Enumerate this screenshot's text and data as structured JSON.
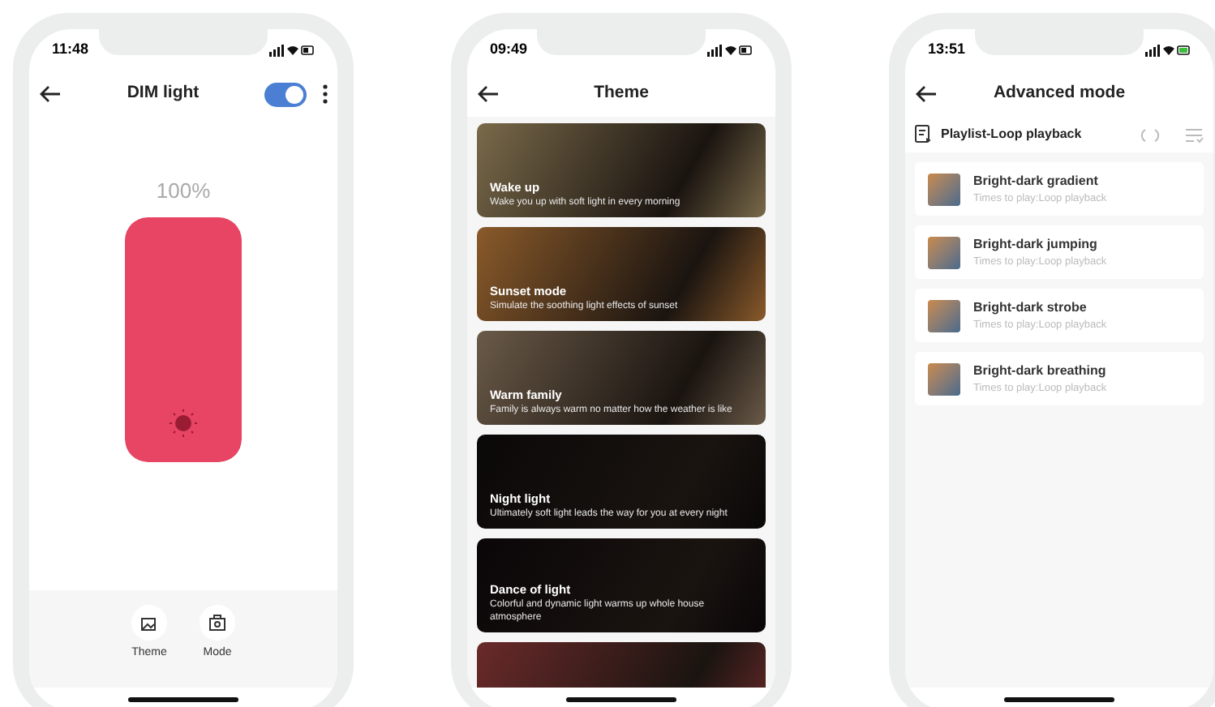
{
  "phones": [
    {
      "kind": "dimmer",
      "time": "11:48",
      "title": "DIM light",
      "power_on": true,
      "percent": "100%",
      "brightness": {
        "level": 1
      },
      "nav": [
        {
          "label": "Theme",
          "kind": "image"
        },
        {
          "label": "Mode",
          "kind": "mode"
        }
      ]
    },
    {
      "kind": "themes",
      "time": "09:49",
      "title": "Theme",
      "cards": [
        {
          "title": "Wake up",
          "description": "Wake you up with soft light in every morning",
          "color": "#7a6a4a"
        },
        {
          "title": "Sunset mode",
          "description": "Simulate the soothing light effects of sunset",
          "color": "#8a5a2a"
        },
        {
          "title": "Warm family",
          "description": "Family is always warm no matter how the weather is like",
          "color": "#6a5a48"
        },
        {
          "title": "Night light",
          "description": "Ultimately soft light leads the way for you at every night",
          "color": "#0a0808"
        },
        {
          "title": "Dance of light",
          "description": "Colorful and dynamic light warms up whole house atmosphere",
          "color": "#0a0608"
        },
        {
          "color": "#6a2a2a"
        }
      ]
    },
    {
      "kind": "advanced",
      "time": "13:51",
      "title": "Advanced mode",
      "playlist": "Playlist-Loop playback",
      "items": [
        {
          "title": "Bright-dark gradient",
          "subtitle": "Times to play:Loop playback"
        },
        {
          "title": "Bright-dark jumping",
          "subtitle": "Times to play:Loop playback"
        },
        {
          "title": "Bright-dark strobe",
          "subtitle": "Times to play:Loop playback"
        },
        {
          "title": "Bright-dark breathing",
          "subtitle": "Times to play:Loop playback"
        }
      ]
    }
  ]
}
